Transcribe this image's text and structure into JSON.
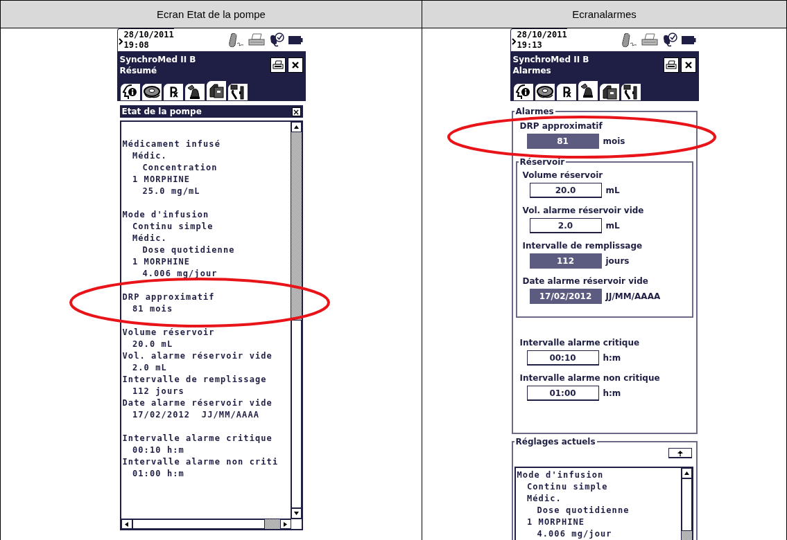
{
  "table": {
    "headers": [
      "Ecran Etat de la pompe",
      "Ecranalarmes"
    ]
  },
  "screens": [
    {
      "kind": "summary",
      "date": "28/10/2011",
      "time": "19:08",
      "device": "SynchroMed II B",
      "page": "Résumé",
      "tabs": [
        {
          "kind": "info",
          "selected": false
        },
        {
          "kind": "pump",
          "selected": false
        },
        {
          "kind": "rx",
          "symbol": "℞",
          "selected": false
        },
        {
          "kind": "bell",
          "selected": false
        },
        {
          "kind": "folder",
          "selected": true
        },
        {
          "kind": "tools",
          "selected": false
        }
      ],
      "panel_title": "Etat de la pompe",
      "panel_close": "×",
      "groups": [
        [
          {
            "text": "Médicament infusé",
            "children": [
              {
                "text": "Médic.",
                "children": [
                  {
                    "text": "Concentration"
                  }
                ]
              },
              {
                "text": "1 MORPHINE",
                "children": [
                  {
                    "text": "25.0 mg/mL"
                  }
                ]
              }
            ]
          }
        ],
        [
          {
            "text": "Mode d'infusion",
            "children": [
              {
                "text": "Continu simple"
              },
              {
                "text": "Médic.",
                "children": [
                  {
                    "text": "Dose quotidienne"
                  }
                ]
              },
              {
                "text": "1 MORPHINE",
                "children": [
                  {
                    "text": "4.006 mg/jour"
                  }
                ]
              }
            ]
          }
        ],
        [
          {
            "text": "DRP approximatif",
            "children": [
              {
                "text": "81 mois"
              }
            ]
          }
        ],
        [
          {
            "text": "Volume réservoir",
            "children": [
              {
                "text": "20.0 mL"
              }
            ]
          },
          {
            "text": "Vol. alarme réservoir vide",
            "children": [
              {
                "text": "2.0 mL"
              }
            ]
          },
          {
            "text": "Intervalle de remplissage",
            "children": [
              {
                "text": "112 jours"
              }
            ]
          },
          {
            "text": "Date alarme réservoir vide",
            "children": [
              {
                "text": "17/02/2012  JJ/MM/AAAA"
              }
            ]
          }
        ],
        [
          {
            "text": "Intervalle alarme critique",
            "children": [
              {
                "text": "00:10 h:m"
              }
            ]
          },
          {
            "text": "Intervalle alarme non criti",
            "children": [
              {
                "text": "01:00 h:m"
              }
            ]
          }
        ]
      ]
    },
    {
      "kind": "alarms",
      "date": "28/10/2011",
      "time": "19:13",
      "device": "SynchroMed II B",
      "page": "Alarmes",
      "tabs": [
        {
          "kind": "info",
          "selected": false
        },
        {
          "kind": "pump",
          "selected": false
        },
        {
          "kind": "rx",
          "symbol": "℞",
          "selected": false
        },
        {
          "kind": "bell",
          "selected": true
        },
        {
          "kind": "folder",
          "selected": false
        },
        {
          "kind": "tools",
          "selected": false
        }
      ],
      "alarms": {
        "legend": "Alarmes",
        "fields": [
          {
            "label": "DRP approximatif",
            "value": "81",
            "unit": "mois",
            "editable": false
          }
        ],
        "reservoir": {
          "legend": "Réservoir",
          "fields": [
            {
              "label": "Volume réservoir",
              "value": "20.0",
              "unit": "mL",
              "editable": true
            },
            {
              "label": "Vol. alarme réservoir vide",
              "value": "2.0",
              "unit": "mL",
              "editable": true
            },
            {
              "label": "Intervalle de remplissage",
              "value": "112",
              "unit": "jours",
              "editable": false
            },
            {
              "label": "Date alarme réservoir vide",
              "value": "17/02/2012",
              "unit": "JJ/MM/AAAA",
              "editable": false
            }
          ]
        },
        "timers": [
          {
            "label": "Intervalle alarme critique",
            "value": "00:10",
            "unit": "h:m",
            "editable": true
          },
          {
            "label": "Intervalle alarme non critique",
            "value": "01:00",
            "unit": "h:m",
            "editable": true
          }
        ]
      },
      "settings": {
        "legend": "Réglages actuels",
        "listing": [
          {
            "text": "Mode d'infusion",
            "children": [
              {
                "text": "Continu simple"
              },
              {
                "text": "Médic.",
                "children": [
                  {
                    "text": "Dose quotidienne"
                  }
                ]
              },
              {
                "text": "1 MORPHINE",
                "children": [
                  {
                    "text": "4.006 mg/jour"
                  }
                ]
              }
            ]
          }
        ]
      }
    }
  ]
}
